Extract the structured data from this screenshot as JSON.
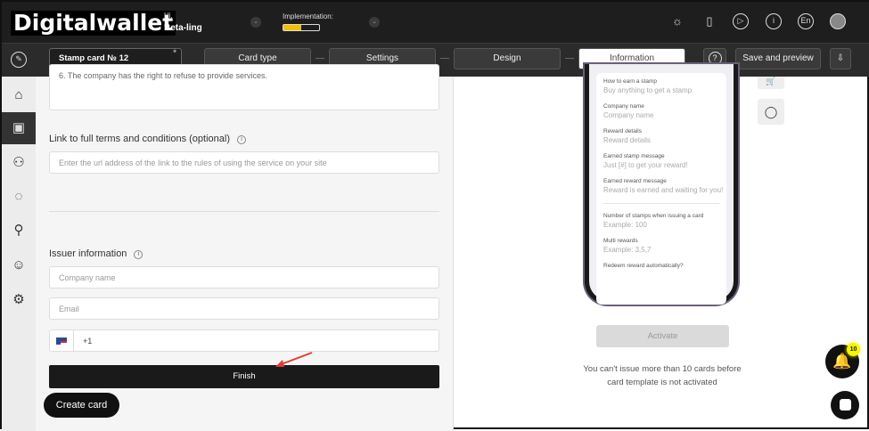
{
  "header": {
    "logo": "Digitalwallet",
    "greeting": "Hi,",
    "user": "Beta-ling",
    "implementation_label": "Implementation:",
    "implementation_progress": 0.5,
    "language": "En"
  },
  "toolbar": {
    "card_name": "Stamp card № 12",
    "required_mark": "*",
    "steps": [
      "Card type",
      "Settings",
      "Design",
      "Information"
    ],
    "active_step": "Information",
    "save_label": "Save and preview",
    "help": "?"
  },
  "form": {
    "textarea_tail": "6. The company has the right to refuse to provide services.",
    "terms_label": "Link to full terms and conditions (optional)",
    "terms_placeholder": "Enter the url address of the link to the rules of using the service on your site",
    "issuer_label": "Issuer information",
    "company_placeholder": "Company name",
    "email_placeholder": "Email",
    "phone_code": "+1",
    "finish_label": "Finish",
    "create_card_label": "Create card"
  },
  "preview": {
    "fields": [
      {
        "label": "How to earn a stamp",
        "value": "Buy anything to get a stamp"
      },
      {
        "label": "Company name",
        "value": "Company name"
      },
      {
        "label": "Reward details",
        "value": "Reward details"
      },
      {
        "label": "Earned stamp message",
        "value": "Just [#] to get your reward!"
      },
      {
        "label": "Earned reward message",
        "value": "Reward is earned and waiting for you!"
      },
      {
        "label": "Number of stamps when issuing a card",
        "value": "Example: 100"
      },
      {
        "label": "Multi rewards",
        "value": "Example: 3,5,7"
      },
      {
        "label": "Redeem reward automatically?",
        "value": ""
      }
    ],
    "activate_label": "Activate",
    "notice": "You can't issue more than 10 cards before card template is not activated"
  },
  "notifications": {
    "count": "10",
    "badge_color": "#f5f500"
  }
}
